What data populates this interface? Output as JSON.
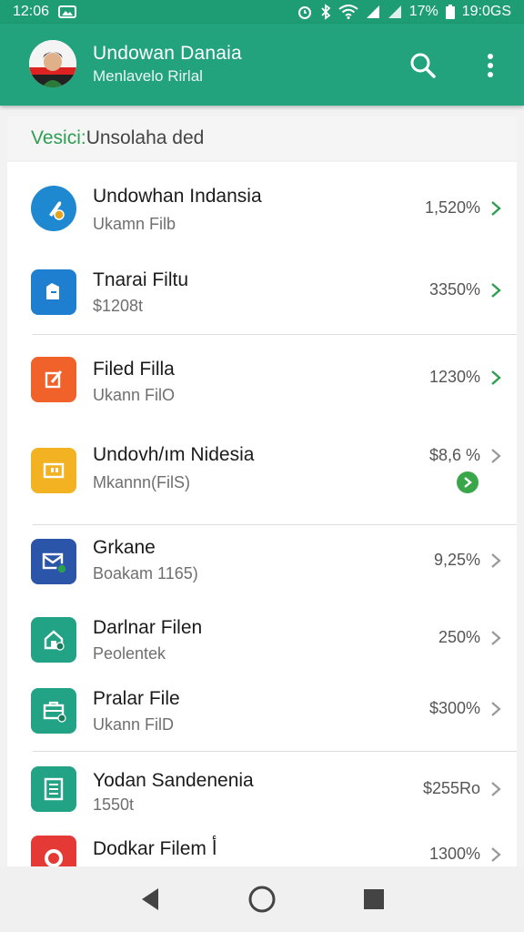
{
  "status_bar": {
    "time_left": "12:06",
    "battery_percent": "17%",
    "time_right": "19:0GS"
  },
  "app_bar": {
    "title": "Undowan Danaia",
    "subtitle": "Menlavelo Rirlal"
  },
  "section": {
    "label_accent": "Vesici:",
    "label_rest": " Unsolaha ded"
  },
  "items": [
    {
      "title": "Undowhan Indansia",
      "subtitle": "Ukamn Filb",
      "value": "1,520%",
      "icon": "pin-icon",
      "color": "#1e88d0"
    },
    {
      "title": "Tnarai Filtu",
      "subtitle": "$1208t",
      "value": "3350%",
      "icon": "folder-icon",
      "color": "#1e7fd0"
    },
    {
      "title": "Filed Filla",
      "subtitle": "Ukann FilO",
      "value": "1230%",
      "icon": "edit-icon",
      "color": "#f0622a"
    },
    {
      "title": "Undovh/ım Nidesia",
      "subtitle": "Mkannn(FilS)",
      "value": "$8,6 %",
      "icon": "box-icon",
      "color": "#f2b221"
    },
    {
      "title": "Grkane",
      "subtitle": "Boakam 1165)",
      "value": "9,25%",
      "icon": "mail-icon",
      "color": "#2a55a8"
    },
    {
      "title": "Darlnar Filen",
      "subtitle": "Peolentek",
      "value": "250%",
      "icon": "home-icon",
      "color": "#22a385"
    },
    {
      "title": "Pralar File",
      "subtitle": "Ukann FilD",
      "value": "$300%",
      "icon": "briefcase-icon",
      "color": "#22a385"
    },
    {
      "title": "Yodan Sandenenia",
      "subtitle": "1550t",
      "value": "$255Ro",
      "icon": "list-icon",
      "color": "#22a385"
    },
    {
      "title": "Dodkar Filem أ",
      "subtitle": "",
      "value": "1300%",
      "icon": "record-icon",
      "color": "#e53935"
    }
  ],
  "colors": {
    "primary": "#22a37d",
    "status": "#1e9c73",
    "accent_green": "#2e9e52"
  }
}
